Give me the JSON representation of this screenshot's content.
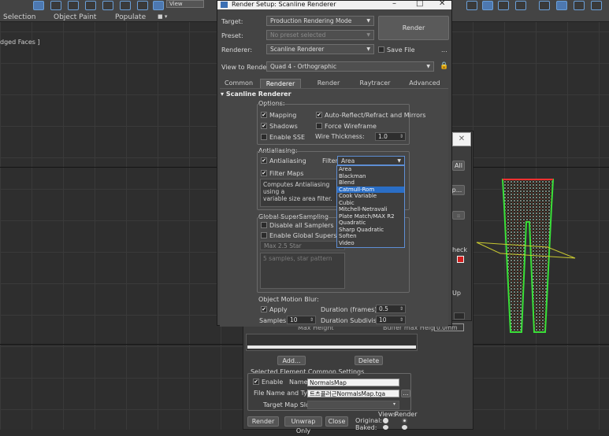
{
  "max": {
    "menu": {
      "selection": "Selection",
      "object_paint": "Object Paint",
      "populate": "Populate"
    },
    "view_dropdown": "View",
    "viewport_label": "dged Faces ]"
  },
  "render_setup": {
    "title": "Render Setup: Scanline Renderer",
    "target_label": "Target:",
    "target_value": "Production Rendering Mode",
    "preset_label": "Preset:",
    "preset_value": "No preset selected",
    "renderer_label": "Renderer:",
    "renderer_value": "Scanline Renderer",
    "save_file_label": "Save File",
    "more_label": "...",
    "render_button": "Render",
    "view_label": "View to Render:",
    "view_value": "Quad 4 - Orthographic",
    "tabs": [
      "Common",
      "Renderer",
      "Render Elements",
      "Raytracer",
      "Advanced Lighting"
    ],
    "rollout_title": "Scanline Renderer",
    "options": {
      "title": "Options:",
      "mapping": "Mapping",
      "auto_reflect": "Auto-Reflect/Refract and Mirrors",
      "shadows": "Shadows",
      "force_wireframe": "Force Wireframe",
      "enable_sse": "Enable SSE",
      "wire_thickness_label": "Wire Thickness:",
      "wire_thickness_value": "1.0"
    },
    "antialiasing": {
      "title": "Antialiasing:",
      "antialiasing": "Antialiasing",
      "filter_label": "Filter:",
      "filter_value": "Area",
      "filter_maps": "Filter Maps",
      "description": "Computes Antialiasing using a\nvariable size area filter."
    },
    "filter_options": [
      "Area",
      "Blackman",
      "Blend",
      "Catmull-Rom",
      "Cook Variable",
      "Cubic",
      "Mitchell-Netravali",
      "Plate Match/MAX R2",
      "Quadratic",
      "Sharp Quadratic",
      "Soften",
      "Video"
    ],
    "filter_selected": "Catmull-Rom",
    "supersampling": {
      "title": "Global SuperSampling",
      "disable_all": "Disable all Samplers",
      "enable_global": "Enable Global Supersampler",
      "sampler": "Max 2.5 Star",
      "desc": "5 samples, star pattern"
    },
    "motion_blur": {
      "title": "Object Motion Blur:",
      "apply": "Apply",
      "duration_label": "Duration (frames):",
      "duration_value": "0.5",
      "samples_label": "Samples:",
      "samples_value": "10",
      "subdiv_label": "Duration Subdivisions:",
      "subdiv_value": "10"
    }
  },
  "render_to_texture": {
    "side_all": "All",
    "side_dots": "p...",
    "side_check": "heck",
    "side_up": "Up",
    "max_height_label": "Max Height",
    "buffer_label": "Buffer max Height",
    "buffer_value": "0.0mm",
    "add_button": "Add...",
    "delete_button": "Delete",
    "common_settings_title": "Selected Element Common Settings",
    "enable_label": "Enable",
    "name_label": "Name:",
    "name_value": "NormalsMap",
    "file_label": "File Name and Type:",
    "file_value": "트츠플러근NormalsMap.tga",
    "browse": "...",
    "target_slot_label": "Target Map Slot:",
    "views_label": "Views",
    "render_label": "Render",
    "original_label": "Original:",
    "baked_label": "Baked:",
    "render_button": "Render",
    "unwrap_button": "Unwrap Only",
    "close_button": "Close"
  }
}
